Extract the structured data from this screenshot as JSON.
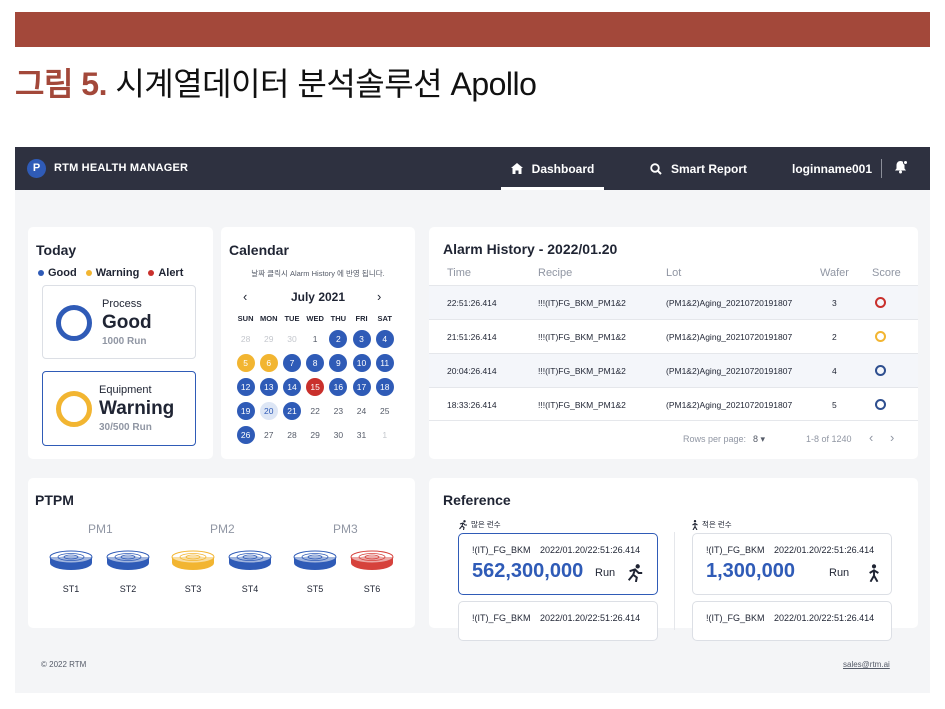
{
  "figure": {
    "number": "그림 5.",
    "title": "시계열데이터 분석솔루션 Apollo"
  },
  "navbar": {
    "logo_letter": "P",
    "brand": "RTM HEALTH MANAGER",
    "tab_dashboard": "Dashboard",
    "tab_smart_report": "Smart Report",
    "username": "loginname001"
  },
  "today": {
    "title": "Today",
    "legend": [
      {
        "label": "Good",
        "color": "#2f5bb7"
      },
      {
        "label": "Warning",
        "color": "#f2b531"
      },
      {
        "label": "Alert",
        "color": "#c9302c"
      }
    ],
    "process": {
      "label": "Process",
      "status": "Good",
      "sub": "1000 Run"
    },
    "equipment": {
      "label": "Equipment",
      "status": "Warning",
      "sub": "30/500 Run"
    }
  },
  "calendar": {
    "title": "Calendar",
    "hint": "날짜 클릭시 Alarm History 에 반영 됩니다.",
    "month": "July 2021",
    "prev": "‹",
    "next": "›",
    "dow": [
      "SUN",
      "MON",
      "TUE",
      "WED",
      "THU",
      "FRI",
      "SAT"
    ],
    "weeks": [
      [
        {
          "d": "28",
          "s": "empty"
        },
        {
          "d": "29",
          "s": "empty"
        },
        {
          "d": "30",
          "s": "empty"
        },
        {
          "d": "1",
          "s": "plain"
        },
        {
          "d": "2",
          "s": "good"
        },
        {
          "d": "3",
          "s": "good"
        },
        {
          "d": "4",
          "s": "good"
        }
      ],
      [
        {
          "d": "5",
          "s": "warn"
        },
        {
          "d": "6",
          "s": "warn"
        },
        {
          "d": "7",
          "s": "good"
        },
        {
          "d": "8",
          "s": "good"
        },
        {
          "d": "9",
          "s": "good"
        },
        {
          "d": "10",
          "s": "good"
        },
        {
          "d": "11",
          "s": "good"
        }
      ],
      [
        {
          "d": "12",
          "s": "good"
        },
        {
          "d": "13",
          "s": "good"
        },
        {
          "d": "14",
          "s": "good"
        },
        {
          "d": "15",
          "s": "alert"
        },
        {
          "d": "16",
          "s": "good"
        },
        {
          "d": "17",
          "s": "good"
        },
        {
          "d": "18",
          "s": "good"
        }
      ],
      [
        {
          "d": "19",
          "s": "good"
        },
        {
          "d": "20",
          "s": "selected"
        },
        {
          "d": "21",
          "s": "good"
        },
        {
          "d": "22",
          "s": "plain"
        },
        {
          "d": "23",
          "s": "plain"
        },
        {
          "d": "24",
          "s": "plain"
        },
        {
          "d": "25",
          "s": "plain"
        }
      ],
      [
        {
          "d": "26",
          "s": "good"
        },
        {
          "d": "27",
          "s": "plain"
        },
        {
          "d": "28",
          "s": "plain"
        },
        {
          "d": "29",
          "s": "plain"
        },
        {
          "d": "30",
          "s": "plain"
        },
        {
          "d": "31",
          "s": "plain"
        },
        {
          "d": "1",
          "s": "empty"
        }
      ]
    ]
  },
  "alarm": {
    "title": "Alarm History - 2022/01.20",
    "columns": [
      "Time",
      "Recipe",
      "Lot",
      "Wafer",
      "Score"
    ],
    "rows": [
      {
        "time": "22:51:26.414",
        "recipe": "!!!(IT)FG_BKM_PM1&2",
        "lot": "(PM1&2)Aging_20210720191807",
        "wafer": "3",
        "score_color": "#c9302c"
      },
      {
        "time": "21:51:26.414",
        "recipe": "!!!(IT)FG_BKM_PM1&2",
        "lot": "(PM1&2)Aging_20210720191807",
        "wafer": "2",
        "score_color": "#f2b531"
      },
      {
        "time": "20:04:26.414",
        "recipe": "!!!(IT)FG_BKM_PM1&2",
        "lot": "(PM1&2)Aging_20210720191807",
        "wafer": "4",
        "score_color": "#2e4f8f"
      },
      {
        "time": "18:33:26.414",
        "recipe": "!!!(IT)FG_BKM_PM1&2",
        "lot": "(PM1&2)Aging_20210720191807",
        "wafer": "5",
        "score_color": "#2e4f8f"
      }
    ],
    "rows_per_page_label": "Rows per page:",
    "rows_per_page_value": "8 ▾",
    "range": "1-8 of 1240",
    "prev": "‹",
    "next": "›"
  },
  "ptpm": {
    "title": "PTPM",
    "groups": [
      {
        "name": "PM1",
        "stations": [
          {
            "name": "ST1",
            "color": "#2f5bb7"
          },
          {
            "name": "ST2",
            "color": "#2f5bb7"
          }
        ]
      },
      {
        "name": "PM2",
        "stations": [
          {
            "name": "ST3",
            "color": "#f2b531"
          },
          {
            "name": "ST4",
            "color": "#2f5bb7"
          }
        ]
      },
      {
        "name": "PM3",
        "stations": [
          {
            "name": "ST5",
            "color": "#2f5bb7"
          },
          {
            "name": "ST6",
            "color": "#d6423c"
          }
        ]
      }
    ]
  },
  "reference": {
    "title": "Reference",
    "many_label": "많은 런수",
    "few_label": "적은 런수",
    "cards": [
      {
        "name": "!(IT)_FG_BKM",
        "date": "2022/01.20/22:51:26.414",
        "value": "562,300,000",
        "unit": "Run"
      },
      {
        "name": "!(IT)_FG_BKM",
        "date": "2022/01.20/22:51:26.414",
        "value": "1,300,000",
        "unit": "Run"
      },
      {
        "name": "!(IT)_FG_BKM",
        "date": "2022/01.20/22:51:26.414"
      },
      {
        "name": "!(IT)_FG_BKM",
        "date": "2022/01.20/22:51:26.414"
      }
    ]
  },
  "footer": {
    "copyright": "© 2022 RTM",
    "email": "sales@rtm.ai"
  },
  "colors": {
    "good": "#2f5bb7",
    "warning": "#f2b531",
    "alert": "#c9302c",
    "nav": "#2e3140",
    "accent_bar": "#a3483a"
  }
}
